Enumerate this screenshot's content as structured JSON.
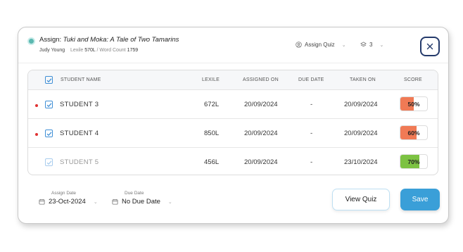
{
  "header": {
    "assign_prefix": "Assign:",
    "book_title": "Tuki and Moka: A Tale of Two Tamarins",
    "author": "Judy Young",
    "lexile_label": "Lexile",
    "lexile_value": "570L",
    "separator": "/",
    "word_count_label": "Word Count",
    "word_count_value": "1759",
    "assign_quiz_label": "Assign Quiz",
    "level_value": "3"
  },
  "table": {
    "columns": {
      "student_name": "STUDENT NAME",
      "lexile": "LEXILE",
      "assigned_on": "ASSIGNED ON",
      "due_date": "DUE DATE",
      "taken_on": "TAKEN ON",
      "score": "SCORE"
    },
    "rows": [
      {
        "name": "STUDENT 3",
        "lexile": "672L",
        "assigned_on": "20/09/2024",
        "due_date": "-",
        "taken_on": "20/09/2024",
        "score": "50%",
        "score_value": 50,
        "score_color": "#f07a55",
        "dot": true
      },
      {
        "name": "STUDENT 4",
        "lexile": "850L",
        "assigned_on": "20/09/2024",
        "due_date": "-",
        "taken_on": "20/09/2024",
        "score": "60%",
        "score_value": 60,
        "score_color": "#f07a55",
        "dot": true
      },
      {
        "name": "STUDENT 5",
        "lexile": "456L",
        "assigned_on": "20/09/2024",
        "due_date": "-",
        "taken_on": "23/10/2024",
        "score": "70%",
        "score_value": 70,
        "score_color": "#7cc242",
        "dot": false
      }
    ]
  },
  "footer": {
    "assign_date_label": "Assign Date",
    "assign_date_value": "23-Oct-2024",
    "due_date_label": "Due Date",
    "due_date_value": "No Due Date",
    "view_quiz_label": "View Quiz",
    "save_label": "Save"
  },
  "colors": {
    "accent": "#3a9fd8",
    "close_border": "#243a6b",
    "alert_dot": "#e03131"
  }
}
